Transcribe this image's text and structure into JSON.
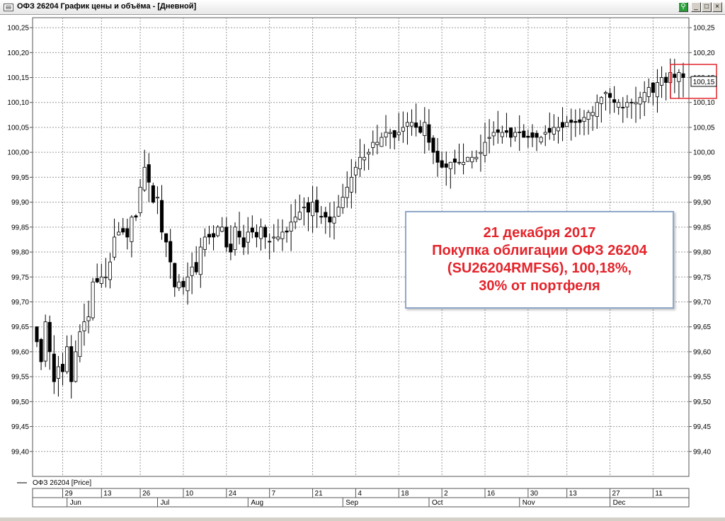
{
  "window": {
    "title": "ОФЗ 26204 График цены и объёма - [Дневной]",
    "buttons": [
      "_",
      "□",
      "×"
    ]
  },
  "legend": {
    "label": "ОФЗ 26204 [Price]"
  },
  "annotation": {
    "lines": [
      "21 декабря 2017",
      "Покупка облигации ОФЗ 26204",
      "(SU26204RMFS6), 100,18%,",
      "30% от портфеля"
    ],
    "color": "#e3242b"
  },
  "last_price_label": "100,15",
  "chart_data": {
    "type": "candlestick",
    "title": "",
    "xlabel": "",
    "ylabel": "",
    "ylim": [
      99.35,
      100.27
    ],
    "y_ticks": [
      "100,25",
      "100,20",
      "100,15",
      "100,10",
      "100,05",
      "100,00",
      "99,95",
      "99,90",
      "99,85",
      "99,80",
      "99,75",
      "99,70",
      "99,65",
      "99,60",
      "99,55",
      "99,50",
      "99,45",
      "99,40"
    ],
    "grid": true,
    "bar_count": 151,
    "day_ticks": [
      {
        "label": "29",
        "bar": 6
      },
      {
        "label": "13",
        "bar": 15
      },
      {
        "label": "26",
        "bar": 24
      },
      {
        "label": "10",
        "bar": 34
      },
      {
        "label": "24",
        "bar": 44
      },
      {
        "label": "7",
        "bar": 54
      },
      {
        "label": "21",
        "bar": 64
      },
      {
        "label": "4",
        "bar": 74
      },
      {
        "label": "18",
        "bar": 84
      },
      {
        "label": "2",
        "bar": 94
      },
      {
        "label": "16",
        "bar": 104
      },
      {
        "label": "30",
        "bar": 114
      },
      {
        "label": "13",
        "bar": 123
      },
      {
        "label": "27",
        "bar": 133
      },
      {
        "label": "11",
        "bar": 143
      }
    ],
    "months": [
      {
        "label": "Jun",
        "bar": 8
      },
      {
        "label": "Jul",
        "bar": 29
      },
      {
        "label": "Aug",
        "bar": 50
      },
      {
        "label": "Sep",
        "bar": 72
      },
      {
        "label": "Oct",
        "bar": 92
      },
      {
        "label": "Nov",
        "bar": 113
      },
      {
        "label": "Dec",
        "bar": 134
      }
    ],
    "close_series": [
      99.62,
      99.58,
      99.66,
      99.6,
      99.54,
      99.57,
      99.56,
      99.61,
      99.54,
      99.6,
      99.64,
      99.66,
      99.67,
      99.74,
      99.74,
      99.75,
      99.75,
      99.78,
      99.83,
      99.84,
      99.84,
      99.83,
      99.87,
      99.87,
      99.93,
      99.97,
      99.94,
      99.9,
      99.91,
      99.84,
      99.82,
      99.78,
      99.73,
      99.74,
      99.73,
      99.75,
      99.77,
      99.76,
      99.81,
      99.83,
      99.83,
      99.83,
      99.85,
      99.85,
      99.81,
      99.8,
      99.85,
      99.83,
      99.81,
      99.84,
      99.84,
      99.83,
      99.85,
      99.83,
      99.82,
      99.83,
      99.83,
      99.84,
      99.84,
      99.86,
      99.87,
      99.88,
      99.89,
      99.88,
      99.9,
      99.88,
      99.87,
      99.87,
      99.86,
      99.87,
      99.89,
      99.91,
      99.93,
      99.95,
      99.97,
      99.99,
      99.99,
      100.0,
      100.02,
      100.02,
      100.03,
      100.04,
      100.04,
      100.03,
      100.04,
      100.05,
      100.06,
      100.06,
      100.05,
      100.04,
      100.06,
      100.02,
      100.0,
      99.98,
      99.97,
      99.97,
      99.98,
      99.98,
      99.98,
      99.98,
      99.99,
      99.99,
      99.99,
      100.0,
      100.02,
      100.03,
      100.04,
      100.04,
      100.04,
      100.04,
      100.03,
      100.04,
      100.04,
      100.03,
      100.03,
      100.03,
      100.03,
      100.03,
      100.04,
      100.04,
      100.05,
      100.05,
      100.05,
      100.06,
      100.06,
      100.06,
      100.06,
      100.07,
      100.08,
      100.08,
      100.1,
      100.11,
      100.12,
      100.11,
      100.1,
      100.1,
      100.09,
      100.1,
      100.1,
      100.1,
      100.11,
      100.12,
      100.13,
      100.12,
      100.14,
      100.15,
      100.14,
      100.16,
      100.15,
      100.16,
      100.15
    ]
  }
}
